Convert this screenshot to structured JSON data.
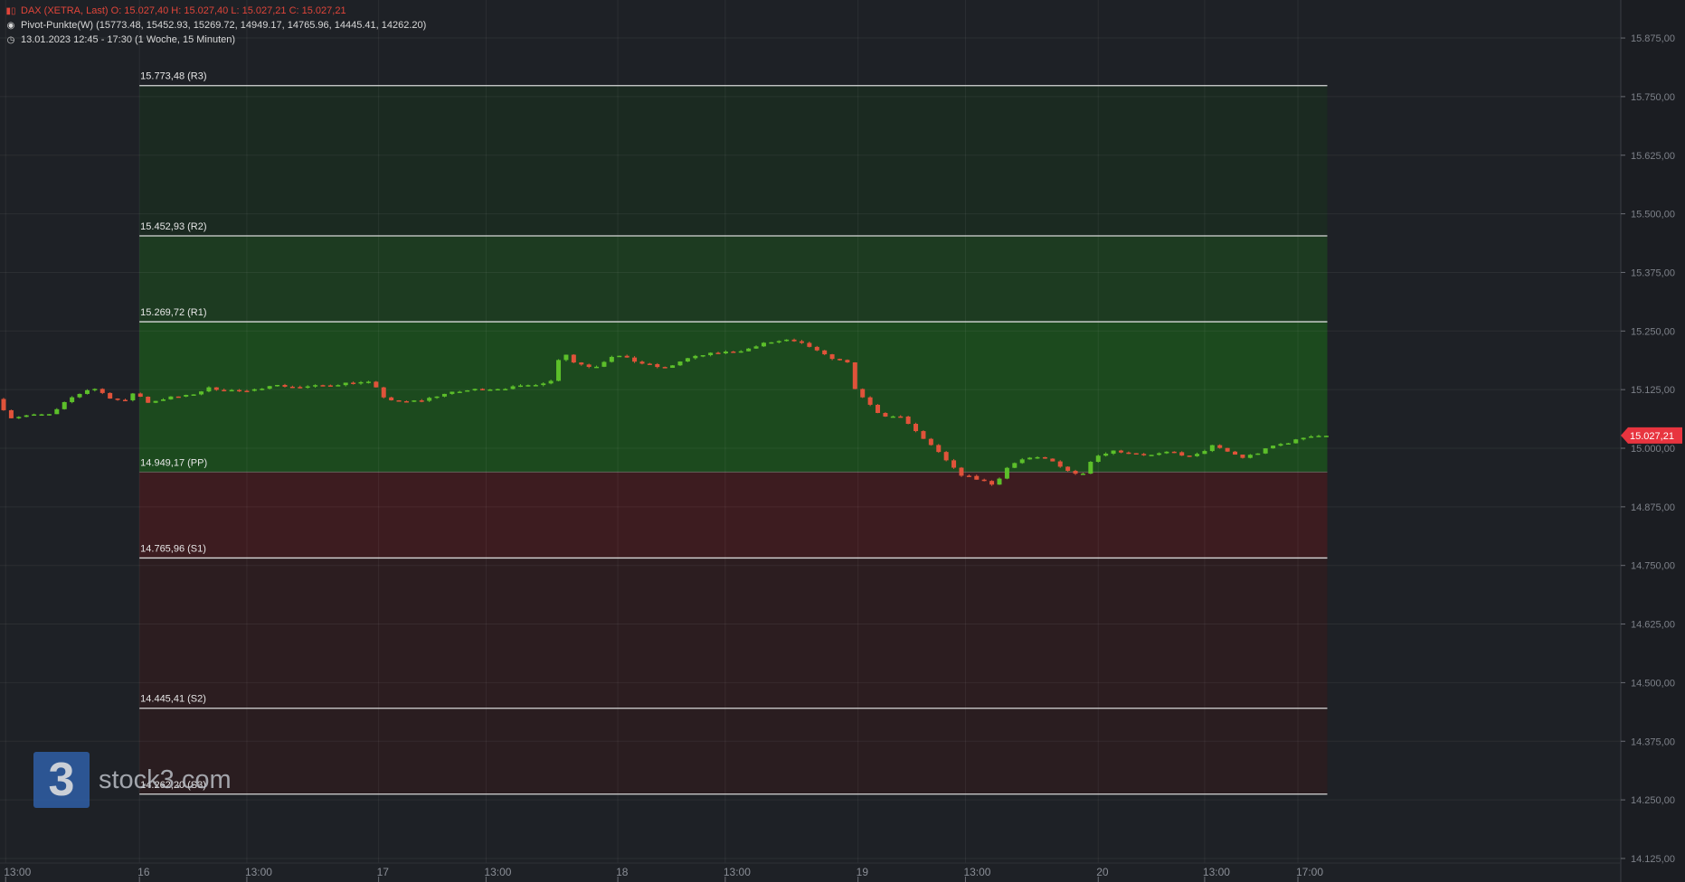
{
  "header": {
    "symbol_line": "DAX (XETRA, Last)  O: 15.027,40  H: 15.027,40  L: 15.027,21  C: 15.027,21",
    "indicator_line": "Pivot-Punkte(W)  (15773.48, 15452.93, 15269.72, 14949.17, 14765.96, 14445.41, 14262.20)",
    "time_line": "13.01.2023 12:45 - 17:30   (1 Woche, 15 Minuten)",
    "symbol_icon": "candlestick-icon",
    "indicator_icon": "radio-dot-icon",
    "time_icon": "clock-icon"
  },
  "watermark": {
    "logo_glyph": "3",
    "text": "stock3.com"
  },
  "colors": {
    "background": "#1e2126",
    "up": "#5cbf2a",
    "down": "#e0533a",
    "price_tag": "#e8343f",
    "zone_up_strong": "#1c4a1e",
    "zone_up_light": "#1b2a21",
    "zone_down_strong": "#3d1c20",
    "zone_down_light": "#2c1d20"
  },
  "chart_data": {
    "type": "candlestick",
    "ylim": [
      14125,
      15950
    ],
    "y_ticks": [
      15875,
      15750,
      15625,
      15500,
      15375,
      15250,
      15125,
      15000,
      14875,
      14750,
      14625,
      14500,
      14375,
      14250,
      14125
    ],
    "y_tick_labels": [
      "15.875,00",
      "15.750,00",
      "15.625,00",
      "15.500,00",
      "15.375,00",
      "15.250,00",
      "15.125,00",
      "15.000,00",
      "14.875,00",
      "14.750,00",
      "14.625,00",
      "14.500,00",
      "14.375,00",
      "14.250,00",
      "14.125,00"
    ],
    "x_range_slots": [
      0,
      1530
    ],
    "x_ticks": [
      {
        "slot": 2,
        "label": "13:00"
      },
      {
        "slot": 134,
        "label": "16"
      },
      {
        "slot": 240,
        "label": "13:00"
      },
      {
        "slot": 370,
        "label": "17"
      },
      {
        "slot": 476,
        "label": "13:00"
      },
      {
        "slot": 606,
        "label": "18"
      },
      {
        "slot": 712,
        "label": "13:00"
      },
      {
        "slot": 843,
        "label": "19"
      },
      {
        "slot": 949,
        "label": "13:00"
      },
      {
        "slot": 1080,
        "label": "20"
      },
      {
        "slot": 1185,
        "label": "13:00"
      },
      {
        "slot": 1277,
        "label": "17:00"
      }
    ],
    "pivot_levels": [
      {
        "name": "R3",
        "value": 15773.48,
        "label": "15.773,48 (R3)"
      },
      {
        "name": "R2",
        "value": 15452.93,
        "label": "15.452,93 (R2)"
      },
      {
        "name": "R1",
        "value": 15269.72,
        "label": "15.269,72 (R1)"
      },
      {
        "name": "PP",
        "value": 14949.17,
        "label": "14.949,17 (PP)"
      },
      {
        "name": "S1",
        "value": 14765.96,
        "label": "14.765,96 (S1)"
      },
      {
        "name": "S2",
        "value": 14445.41,
        "label": "14.445,41 (S2)"
      },
      {
        "name": "S3",
        "value": 14262.2,
        "label": "14.262,20 (S3)"
      }
    ],
    "pivot_span_slots": [
      134,
      1306
    ],
    "last_price": {
      "value": 15027.21,
      "label": "15.027,21"
    },
    "series": [
      {
        "name": "DAX",
        "anchors": [
          [
            0,
            15105
          ],
          [
            14,
            15065
          ],
          [
            30,
            15070
          ],
          [
            55,
            15072
          ],
          [
            72,
            15105
          ],
          [
            95,
            15130
          ],
          [
            115,
            15105
          ],
          [
            128,
            15100
          ],
          [
            136,
            15120
          ],
          [
            150,
            15098
          ],
          [
            170,
            15108
          ],
          [
            190,
            15112
          ],
          [
            210,
            15128
          ],
          [
            250,
            15120
          ],
          [
            270,
            15135
          ],
          [
            300,
            15130
          ],
          [
            330,
            15135
          ],
          [
            350,
            15140
          ],
          [
            371,
            15140
          ],
          [
            380,
            15112
          ],
          [
            395,
            15098
          ],
          [
            420,
            15102
          ],
          [
            440,
            15115
          ],
          [
            470,
            15125
          ],
          [
            500,
            15128
          ],
          [
            520,
            15132
          ],
          [
            552,
            15145
          ],
          [
            557,
            15220
          ],
          [
            567,
            15185
          ],
          [
            590,
            15172
          ],
          [
            610,
            15200
          ],
          [
            635,
            15182
          ],
          [
            660,
            15170
          ],
          [
            680,
            15190
          ],
          [
            700,
            15200
          ],
          [
            740,
            15210
          ],
          [
            760,
            15225
          ],
          [
            780,
            15230
          ],
          [
            800,
            15220
          ],
          [
            815,
            15200
          ],
          [
            835,
            15185
          ],
          [
            840,
            15185
          ],
          [
            848,
            15120
          ],
          [
            860,
            15098
          ],
          [
            872,
            15070
          ],
          [
            895,
            15065
          ],
          [
            905,
            15040
          ],
          [
            930,
            14990
          ],
          [
            950,
            14945
          ],
          [
            975,
            14930
          ],
          [
            985,
            14920
          ],
          [
            995,
            14955
          ],
          [
            1010,
            14975
          ],
          [
            1030,
            14980
          ],
          [
            1045,
            14970
          ],
          [
            1055,
            14955
          ],
          [
            1065,
            14945
          ],
          [
            1070,
            14940
          ],
          [
            1082,
            14980
          ],
          [
            1100,
            14995
          ],
          [
            1120,
            14990
          ],
          [
            1140,
            14985
          ],
          [
            1160,
            14992
          ],
          [
            1180,
            14980
          ],
          [
            1200,
            15005
          ],
          [
            1230,
            14980
          ],
          [
            1245,
            14990
          ],
          [
            1260,
            15005
          ],
          [
            1280,
            15015
          ],
          [
            1295,
            15027
          ],
          [
            1306,
            15027
          ]
        ]
      }
    ]
  }
}
